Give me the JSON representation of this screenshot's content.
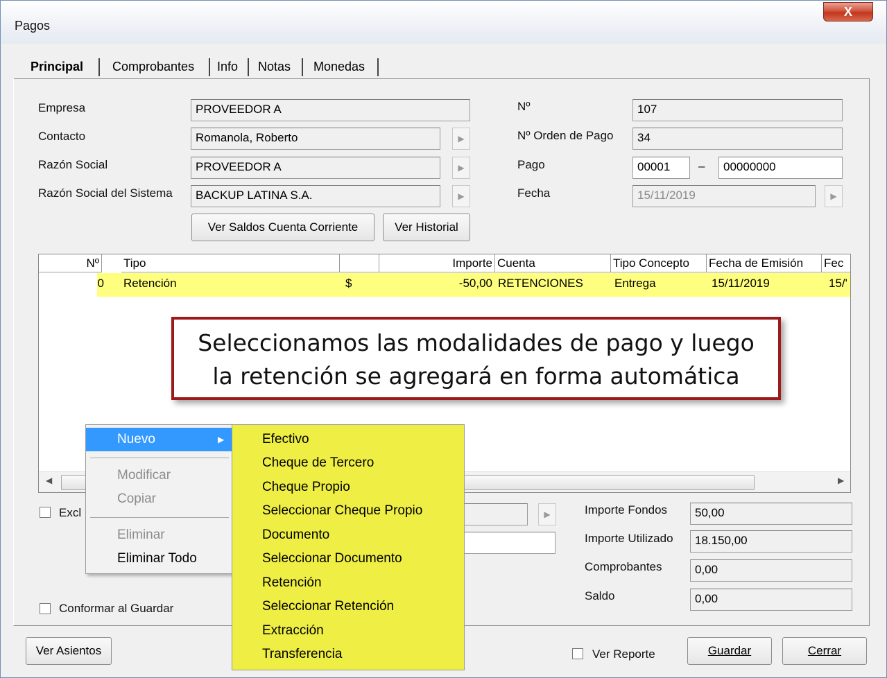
{
  "window": {
    "title": "Pagos",
    "close_glyph": "X"
  },
  "tabs": [
    "Principal",
    "Comprobantes",
    "Info",
    "Notas",
    "Monedas"
  ],
  "left_fields": [
    {
      "label": "Empresa",
      "value": "PROVEEDOR A"
    },
    {
      "label": "Contacto",
      "value": "Romanola, Roberto"
    },
    {
      "label": "Razón Social",
      "value": "PROVEEDOR A"
    },
    {
      "label": "Razón Social del Sistema",
      "value": "BACKUP LATINA S.A."
    }
  ],
  "right_fields": {
    "numero_label": "Nº",
    "numero_value": "107",
    "orden_label": "Nº Orden de Pago",
    "orden_value": "34",
    "pago_label": "Pago",
    "pago_prefix": "00001",
    "pago_dash": "–",
    "pago_number": "00000000",
    "fecha_label": "Fecha",
    "fecha_value": "15/11/2019"
  },
  "buttons": {
    "ver_saldos": "Ver Saldos Cuenta Corriente",
    "ver_historial": "Ver Historial",
    "ver_asientos": "Ver Asientos",
    "guardar": "Guardar",
    "cerrar": "Cerrar"
  },
  "grid": {
    "headers": [
      "Nº",
      "Tipo",
      "",
      "",
      "Importe",
      "Cuenta",
      "Tipo Concepto",
      "Fecha de Emisión",
      "Fec"
    ],
    "row": {
      "numero": "0",
      "tipo": "Retención",
      "moneda": "$",
      "importe": "-50,00",
      "cuenta": "RETENCIONES",
      "tipo_concepto": "Entrega",
      "fecha_emision": "15/11/2019",
      "fecha_trunc": "15/'"
    }
  },
  "callout": {
    "line1": "Seleccionamos las modalidades de pago y luego",
    "line2": "la retención se agregará en forma automática"
  },
  "context_menu": {
    "nuevo": "Nuevo",
    "modificar": "Modificar",
    "copiar": "Copiar",
    "eliminar": "Eliminar",
    "eliminar_todo": "Eliminar Todo"
  },
  "submenu": [
    "Efectivo",
    "Cheque de Tercero",
    "Cheque Propio",
    "Seleccionar Cheque Propio",
    "Documento",
    "Seleccionar Documento",
    "Retención",
    "Seleccionar Retención",
    "Extracción",
    "Transferencia"
  ],
  "bottom": {
    "excl_label": "Excl",
    "conformar_label": "Conformar al Guardar",
    "ver_reporte_label": "Ver Reporte"
  },
  "totals": [
    {
      "label": "Importe Fondos",
      "value": "50,00"
    },
    {
      "label": "Importe Utilizado",
      "value": "18.150,00"
    },
    {
      "label": "Comprobantes",
      "value": "0,00"
    },
    {
      "label": "Saldo",
      "value": "0,00"
    }
  ],
  "colors": {
    "highlight_row": "#ffff7f",
    "submenu_bg": "#eeee44",
    "menu_highlight": "#3399ff",
    "callout_border": "#9e1a1a"
  }
}
